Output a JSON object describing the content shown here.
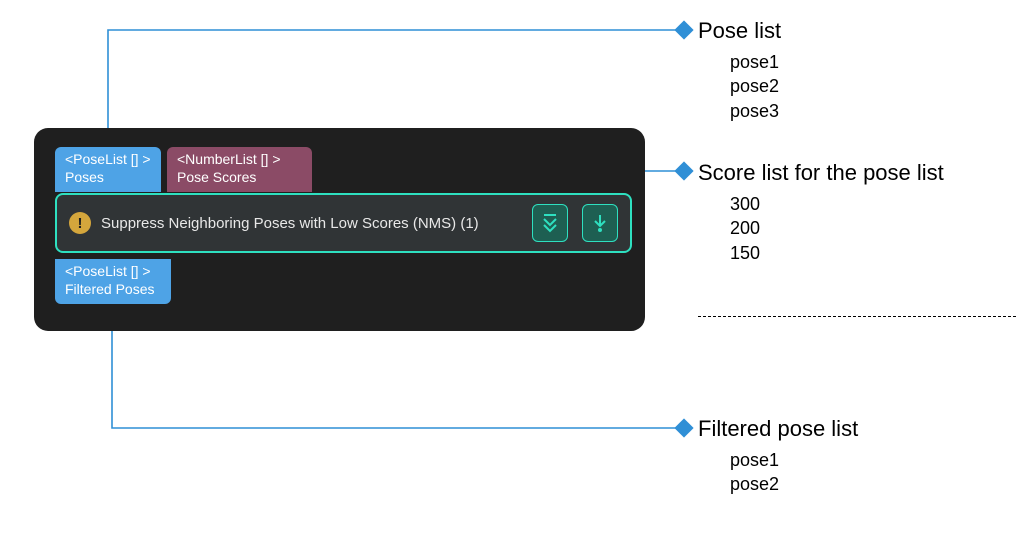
{
  "colors": {
    "connector": "#2f8fd6",
    "panel_bg": "#1f1f1f",
    "port_blue": "#4ea3e6",
    "port_mauve": "#8b4b66",
    "node_bg": "#303436",
    "node_border": "#2ee0c0",
    "warn_bg": "#d4a63c"
  },
  "node": {
    "input_ports": {
      "poses": {
        "type": "<PoseList [] >",
        "label": "Poses"
      },
      "scores": {
        "type": "<NumberList [] >",
        "label": "Pose Scores"
      }
    },
    "title": "Suppress Neighboring Poses with Low Scores (NMS) (1)",
    "warn_glyph": "!",
    "buttons": {
      "collapse": "chevrons-down-icon",
      "step_into": "arrow-down-into-icon"
    },
    "output_ports": {
      "filtered": {
        "type": "<PoseList [] >",
        "label": "Filtered Poses"
      }
    }
  },
  "annotations": {
    "pose_list": {
      "heading": "Pose list",
      "items": [
        "pose1",
        "pose2",
        "pose3"
      ]
    },
    "score_list": {
      "heading": "Score list for the pose list",
      "items": [
        "300",
        "200",
        "150"
      ]
    },
    "filtered_list": {
      "heading": "Filtered pose list",
      "items": [
        "pose1",
        "pose2"
      ]
    }
  }
}
